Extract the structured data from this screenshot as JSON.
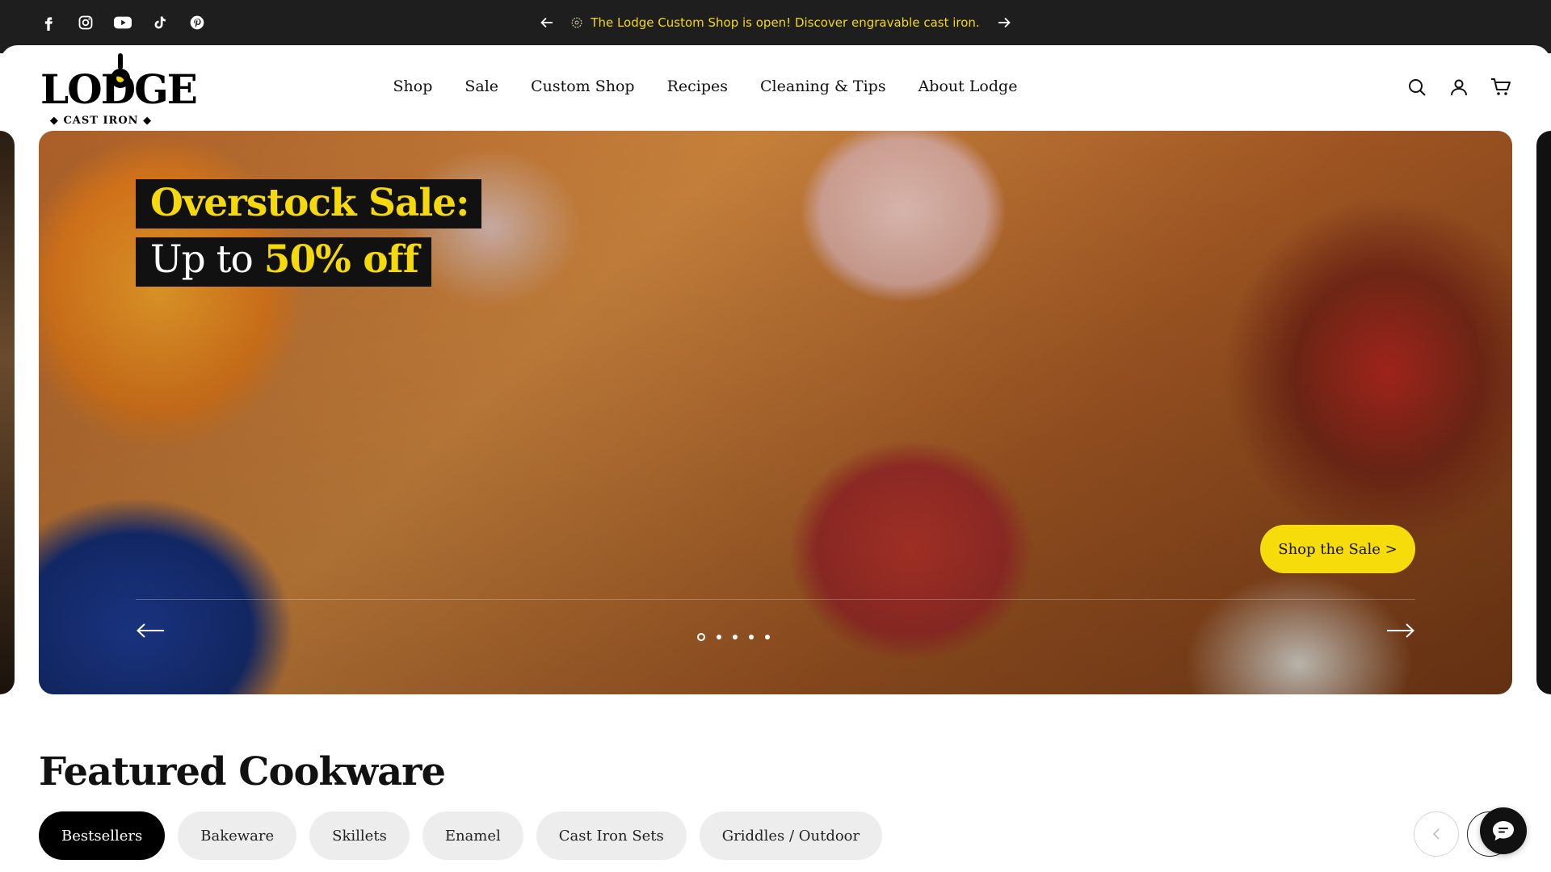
{
  "announcement": {
    "message": "The Lodge Custom Shop is open! Discover engravable cast iron.",
    "prev_icon": "arrow-left-icon",
    "next_icon": "arrow-right-icon",
    "text_color": "#f5d90a"
  },
  "social": [
    "facebook-icon",
    "instagram-icon",
    "youtube-icon",
    "tiktok-icon",
    "pinterest-icon"
  ],
  "brand": {
    "name": "LODGE",
    "tagline": "CAST IRON"
  },
  "nav": {
    "items": [
      {
        "label": "Shop"
      },
      {
        "label": "Sale"
      },
      {
        "label": "Custom Shop"
      },
      {
        "label": "Recipes"
      },
      {
        "label": "Cleaning & Tips"
      },
      {
        "label": "About Lodge"
      }
    ]
  },
  "header_icons": [
    "search-icon",
    "account-icon",
    "cart-icon"
  ],
  "hero": {
    "headline": "Overstock Sale:",
    "subline_prefix": "Up to ",
    "subline_highlight": "50% off",
    "cta": "Shop the Sale >",
    "slide_count": 5,
    "active_slide": 1,
    "accent_color": "#f7dc0c"
  },
  "featured": {
    "title": "Featured Cookware",
    "tabs": [
      {
        "label": "Bestsellers",
        "active": true
      },
      {
        "label": "Bakeware",
        "active": false
      },
      {
        "label": "Skillets",
        "active": false
      },
      {
        "label": "Enamel",
        "active": false
      },
      {
        "label": "Cast Iron Sets",
        "active": false
      },
      {
        "label": "Griddles / Outdoor",
        "active": false
      }
    ]
  },
  "chat": {
    "icon": "chat-icon"
  }
}
